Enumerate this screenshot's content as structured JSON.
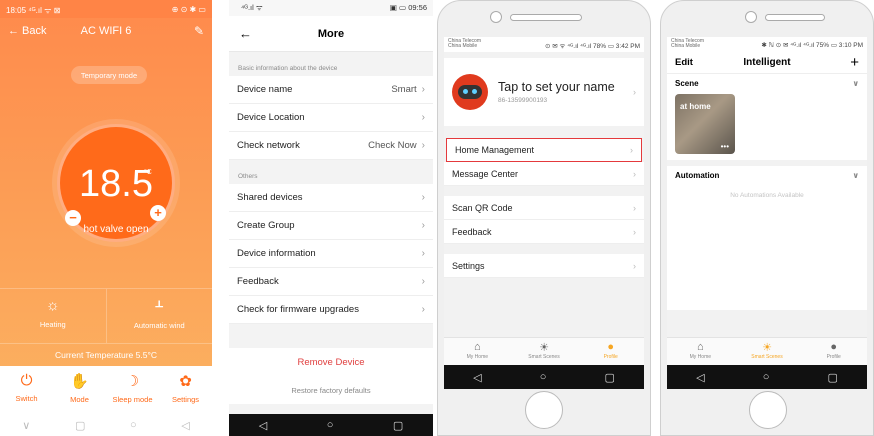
{
  "thermo": {
    "status_left": "18:05 ⁴ᴳ.ıl ᯤ ⊠",
    "status_right": "⊕ ⊙ ✱ ▭",
    "back_label": "← Back",
    "title": "AC WIFI 6",
    "edit_icon": "✎",
    "mode_pill": "Temporary mode",
    "temperature": "18.5",
    "unit": "°C",
    "valve_status": "hot valve open",
    "minus": "−",
    "plus": "+",
    "heating_label": "Heating",
    "wind_label": "Automatic wind",
    "current_temp": "Current Temperature  5.5°C",
    "bottom": [
      {
        "icon": "⏻",
        "label": "Switch"
      },
      {
        "icon": "✋",
        "label": "Mode"
      },
      {
        "icon": "☽",
        "label": "Sleep mode"
      },
      {
        "icon": "✿",
        "label": "Settings"
      }
    ],
    "accent": "#ff6a1a"
  },
  "more": {
    "status_left": "⁴ᴳ.ıl ᯤ",
    "status_right": "▣ ▭ 09:56",
    "title": "More",
    "section_basic": "Basic information about the device",
    "device_name": {
      "label": "Device name",
      "value": "Smart"
    },
    "device_location": {
      "label": "Device Location"
    },
    "check_network": {
      "label": "Check network",
      "value": "Check Now"
    },
    "section_others": "Others",
    "shared_devices": "Shared devices",
    "create_group": "Create Group",
    "device_information": "Device information",
    "feedback": "Feedback",
    "firmware": "Check for firmware upgrades",
    "remove_device": "Remove Device",
    "restore_defaults": "Restore factory defaults"
  },
  "profile": {
    "carrier": "China Telecom\nChina Mobile",
    "status_right": "⊙ ✉ ᯤ ⁴ᴳ.ıl ⁴ᴳ.ıl 78% ▭ 3:42 PM",
    "set_name": "Tap to set your name",
    "phone": "86-13599900193",
    "home_management": "Home Management",
    "message_center": "Message Center",
    "scan_qr": "Scan QR Code",
    "feedback": "Feedback",
    "settings": "Settings"
  },
  "intelligent": {
    "carrier": "China Telecom\nChina Mobile",
    "status_right": "✱ ℕ ⊙ ✉ ⁴ᴳ.ıl ⁴ᴳ.ıl 75% ▭ 3:10 PM",
    "edit": "Edit",
    "title": "Intelligent",
    "add": "+",
    "scene_header": "Scene",
    "scene_card": "at home",
    "automation_header": "Automation",
    "no_automations": "No Automations Available"
  },
  "tabs": {
    "my_home": "My Home",
    "smart_scenes": "Smart Scenes",
    "profile": "Profile"
  }
}
